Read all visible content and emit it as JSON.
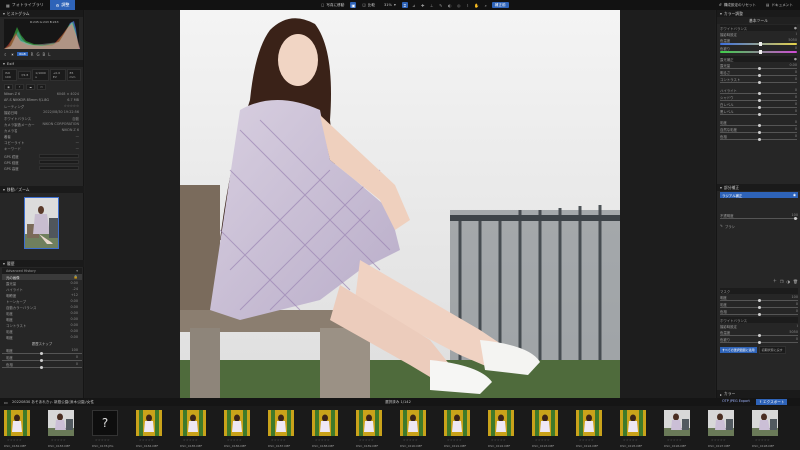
{
  "app": {
    "tabs": [
      {
        "label": "フォトライブラリ",
        "active": false
      },
      {
        "label": "調整",
        "active": true
      }
    ],
    "toolbar": {
      "pick_label": "写真に移動",
      "compare_label": "比較",
      "zoom_label": "31%",
      "preview_label": "補正前",
      "right_buttons": [
        "構成設定のリセット",
        "ドキュメント"
      ]
    }
  },
  "left_panel": {
    "histogram": {
      "title": "ヒストグラム",
      "rgb_readout": "R:245 G:243 B:243"
    },
    "exif": {
      "title": "Exif",
      "badges": [
        "ISO 100",
        "f/2.8",
        "1/1000 s",
        "+0.0 EV",
        "85 mm"
      ],
      "rows": [
        {
          "label": "Nikon Z 6",
          "value": "6048 × 4024"
        },
        {
          "label": "AF-S NIKKOR 85mm f/1.8G",
          "value": "6.7 MB"
        }
      ],
      "meta": [
        {
          "label": "レーティング",
          "value": "☆☆☆☆☆"
        },
        {
          "label": "撮影日時",
          "value": "2022/08/30 19:22:56"
        },
        {
          "label": "ホワイトバランス",
          "value": "自動"
        },
        {
          "label": "カメラ製造メーカー",
          "value": "NIKON CORPORATION"
        },
        {
          "label": "カメラ名",
          "value": "NIKON Z 6"
        },
        {
          "label": "著者",
          "value": "—"
        },
        {
          "label": "コピーライト",
          "value": "—"
        },
        {
          "label": "キーワード",
          "value": "—"
        }
      ],
      "extra_fields": [
        "GPS 緯度",
        "GPS 経度",
        "GPS 高度"
      ]
    },
    "navigator": {
      "title": "移動／ズーム"
    },
    "history": {
      "title": "履歴",
      "mode": "Advanced History",
      "selected": "元の画像",
      "items": [
        {
          "label": "露光量",
          "value": "0.00"
        },
        {
          "label": "ハイライト",
          "value": "-24"
        },
        {
          "label": "明瞭度",
          "value": "+12"
        },
        {
          "label": "トーンカーブ",
          "value": "0.00"
        },
        {
          "label": "自動カラーバランス",
          "value": "0.00"
        },
        {
          "label": "彩度",
          "value": "0.00"
        },
        {
          "label": "明度",
          "value": "0.00"
        },
        {
          "label": "コントラスト",
          "value": "0.00"
        },
        {
          "label": "彩度",
          "value": "0.00"
        },
        {
          "label": "明度",
          "value": "0.00"
        }
      ],
      "footer_title": "履歴スナップ",
      "snap_rows": [
        {
          "label": "明度",
          "value": "100"
        },
        {
          "label": "彩度",
          "value": "0"
        },
        {
          "label": "色相",
          "value": "0"
        }
      ]
    }
  },
  "right_panel": {
    "header": "カラー調整",
    "section1": "基本ツール",
    "white_balance": {
      "title": "ホワイトバランス",
      "mode_label": "撮影時設定",
      "temp_label": "色温度",
      "temp_value": "5050",
      "tint_label": "色被り",
      "tint_value": "0"
    },
    "exposure": {
      "title": "露光補正",
      "rows": [
        {
          "label": "露光量",
          "value": "0.00"
        },
        {
          "label": "明るさ",
          "value": "0"
        },
        {
          "label": "コントラスト",
          "value": "0"
        }
      ]
    },
    "tone": {
      "rows": [
        {
          "label": "ハイライト",
          "value": "0"
        },
        {
          "label": "シャドウ",
          "value": "0"
        },
        {
          "label": "白レベル",
          "value": "0"
        },
        {
          "label": "黒レベル",
          "value": "0"
        }
      ]
    },
    "color": {
      "rows": [
        {
          "label": "彩度",
          "value": "0"
        },
        {
          "label": "自然な彩度",
          "value": "0"
        },
        {
          "label": "色相",
          "value": "0"
        }
      ]
    },
    "local": {
      "title": "部分補正",
      "active_label": "ラジアル補正",
      "brush_label": "ブラシ",
      "amount_label": "不透明度",
      "amount_value": "100"
    },
    "lower": {
      "title": "マスク",
      "rows": [
        {
          "label": "明度",
          "value": "100"
        },
        {
          "label": "彩度",
          "value": "0"
        },
        {
          "label": "色相",
          "value": "0"
        }
      ],
      "wb_title": "ホワイトバランス",
      "wb_mode": "撮影時設定",
      "wb_rows": [
        {
          "label": "色温度",
          "value": "5050"
        },
        {
          "label": "色被り",
          "value": "0"
        }
      ],
      "apply_label": "すべての選択範囲に適用",
      "reset_label": "初期状態に戻す"
    },
    "bottom_header": "カラー"
  },
  "filmstrip": {
    "folder_path": "20220830 あそあれきぃ 新庭公園(深木公園)/女性",
    "selection": "選択済み 1/142",
    "export_label": "エクスポート",
    "export_options": [
      "OTP JPEG Export"
    ],
    "thumbs": [
      {
        "name": "DSC_0182.NEF",
        "kind": "yellow"
      },
      {
        "name": "DSC_0183.NEF",
        "kind": "girl"
      },
      {
        "name": "DSC_0178.JPG",
        "kind": "missing"
      },
      {
        "name": "DSC_0184.NEF",
        "kind": "yellow"
      },
      {
        "name": "DSC_0185.NEF",
        "kind": "yellow"
      },
      {
        "name": "DSC_0186.NEF",
        "kind": "yellow"
      },
      {
        "name": "DSC_0187.NEF",
        "kind": "yellow"
      },
      {
        "name": "DSC_0188.NEF",
        "kind": "yellow"
      },
      {
        "name": "DSC_0189.NEF",
        "kind": "yellow"
      },
      {
        "name": "DSC_0190.NEF",
        "kind": "yellow"
      },
      {
        "name": "DSC_0191.NEF",
        "kind": "yellow"
      },
      {
        "name": "DSC_0192.NEF",
        "kind": "yellow"
      },
      {
        "name": "DSC_0193.NEF",
        "kind": "yellow"
      },
      {
        "name": "DSC_0194.NEF",
        "kind": "yellow"
      },
      {
        "name": "DSC_0195.NEF",
        "kind": "yellow"
      },
      {
        "name": "DSC_0196.NEF",
        "kind": "girl"
      },
      {
        "name": "DSC_0197.NEF",
        "kind": "girl"
      },
      {
        "name": "DSC_0198.NEF",
        "kind": "girl"
      }
    ]
  },
  "colors": {
    "accent": "#2e63b8",
    "panel": "#262626",
    "bg": "#1f1f1f"
  }
}
